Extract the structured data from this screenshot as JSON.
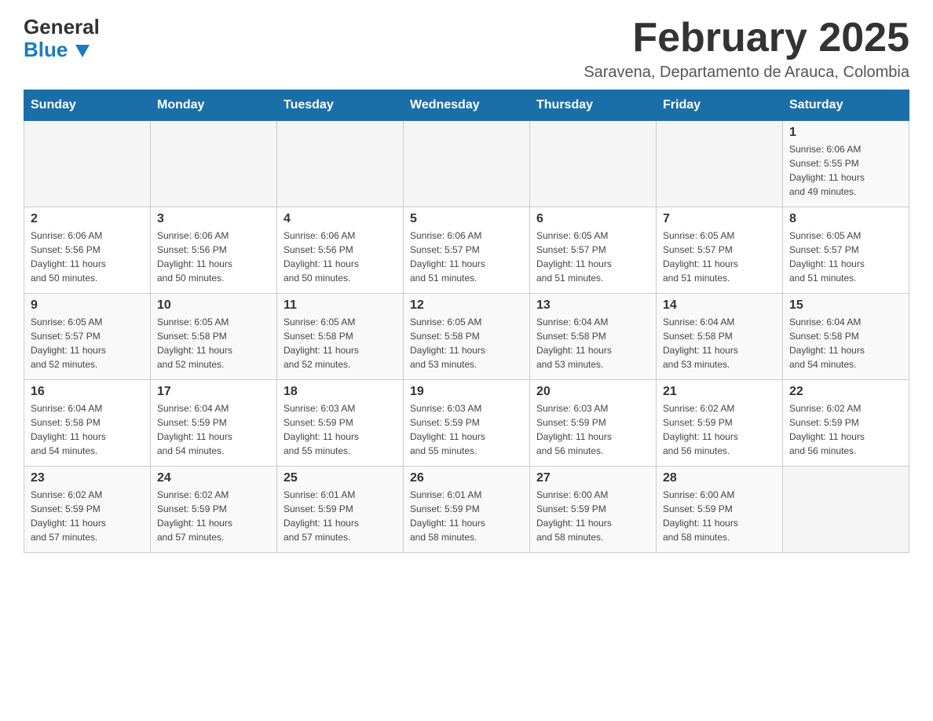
{
  "header": {
    "logo_line1": "General",
    "logo_line2": "Blue",
    "month_year": "February 2025",
    "location": "Saravena, Departamento de Arauca, Colombia"
  },
  "days_of_week": [
    "Sunday",
    "Monday",
    "Tuesday",
    "Wednesday",
    "Thursday",
    "Friday",
    "Saturday"
  ],
  "weeks": [
    {
      "days": [
        {
          "number": "",
          "info": ""
        },
        {
          "number": "",
          "info": ""
        },
        {
          "number": "",
          "info": ""
        },
        {
          "number": "",
          "info": ""
        },
        {
          "number": "",
          "info": ""
        },
        {
          "number": "",
          "info": ""
        },
        {
          "number": "1",
          "info": "Sunrise: 6:06 AM\nSunset: 5:55 PM\nDaylight: 11 hours\nand 49 minutes."
        }
      ]
    },
    {
      "days": [
        {
          "number": "2",
          "info": "Sunrise: 6:06 AM\nSunset: 5:56 PM\nDaylight: 11 hours\nand 50 minutes."
        },
        {
          "number": "3",
          "info": "Sunrise: 6:06 AM\nSunset: 5:56 PM\nDaylight: 11 hours\nand 50 minutes."
        },
        {
          "number": "4",
          "info": "Sunrise: 6:06 AM\nSunset: 5:56 PM\nDaylight: 11 hours\nand 50 minutes."
        },
        {
          "number": "5",
          "info": "Sunrise: 6:06 AM\nSunset: 5:57 PM\nDaylight: 11 hours\nand 51 minutes."
        },
        {
          "number": "6",
          "info": "Sunrise: 6:05 AM\nSunset: 5:57 PM\nDaylight: 11 hours\nand 51 minutes."
        },
        {
          "number": "7",
          "info": "Sunrise: 6:05 AM\nSunset: 5:57 PM\nDaylight: 11 hours\nand 51 minutes."
        },
        {
          "number": "8",
          "info": "Sunrise: 6:05 AM\nSunset: 5:57 PM\nDaylight: 11 hours\nand 51 minutes."
        }
      ]
    },
    {
      "days": [
        {
          "number": "9",
          "info": "Sunrise: 6:05 AM\nSunset: 5:57 PM\nDaylight: 11 hours\nand 52 minutes."
        },
        {
          "number": "10",
          "info": "Sunrise: 6:05 AM\nSunset: 5:58 PM\nDaylight: 11 hours\nand 52 minutes."
        },
        {
          "number": "11",
          "info": "Sunrise: 6:05 AM\nSunset: 5:58 PM\nDaylight: 11 hours\nand 52 minutes."
        },
        {
          "number": "12",
          "info": "Sunrise: 6:05 AM\nSunset: 5:58 PM\nDaylight: 11 hours\nand 53 minutes."
        },
        {
          "number": "13",
          "info": "Sunrise: 6:04 AM\nSunset: 5:58 PM\nDaylight: 11 hours\nand 53 minutes."
        },
        {
          "number": "14",
          "info": "Sunrise: 6:04 AM\nSunset: 5:58 PM\nDaylight: 11 hours\nand 53 minutes."
        },
        {
          "number": "15",
          "info": "Sunrise: 6:04 AM\nSunset: 5:58 PM\nDaylight: 11 hours\nand 54 minutes."
        }
      ]
    },
    {
      "days": [
        {
          "number": "16",
          "info": "Sunrise: 6:04 AM\nSunset: 5:58 PM\nDaylight: 11 hours\nand 54 minutes."
        },
        {
          "number": "17",
          "info": "Sunrise: 6:04 AM\nSunset: 5:59 PM\nDaylight: 11 hours\nand 54 minutes."
        },
        {
          "number": "18",
          "info": "Sunrise: 6:03 AM\nSunset: 5:59 PM\nDaylight: 11 hours\nand 55 minutes."
        },
        {
          "number": "19",
          "info": "Sunrise: 6:03 AM\nSunset: 5:59 PM\nDaylight: 11 hours\nand 55 minutes."
        },
        {
          "number": "20",
          "info": "Sunrise: 6:03 AM\nSunset: 5:59 PM\nDaylight: 11 hours\nand 56 minutes."
        },
        {
          "number": "21",
          "info": "Sunrise: 6:02 AM\nSunset: 5:59 PM\nDaylight: 11 hours\nand 56 minutes."
        },
        {
          "number": "22",
          "info": "Sunrise: 6:02 AM\nSunset: 5:59 PM\nDaylight: 11 hours\nand 56 minutes."
        }
      ]
    },
    {
      "days": [
        {
          "number": "23",
          "info": "Sunrise: 6:02 AM\nSunset: 5:59 PM\nDaylight: 11 hours\nand 57 minutes."
        },
        {
          "number": "24",
          "info": "Sunrise: 6:02 AM\nSunset: 5:59 PM\nDaylight: 11 hours\nand 57 minutes."
        },
        {
          "number": "25",
          "info": "Sunrise: 6:01 AM\nSunset: 5:59 PM\nDaylight: 11 hours\nand 57 minutes."
        },
        {
          "number": "26",
          "info": "Sunrise: 6:01 AM\nSunset: 5:59 PM\nDaylight: 11 hours\nand 58 minutes."
        },
        {
          "number": "27",
          "info": "Sunrise: 6:00 AM\nSunset: 5:59 PM\nDaylight: 11 hours\nand 58 minutes."
        },
        {
          "number": "28",
          "info": "Sunrise: 6:00 AM\nSunset: 5:59 PM\nDaylight: 11 hours\nand 58 minutes."
        },
        {
          "number": "",
          "info": ""
        }
      ]
    }
  ]
}
